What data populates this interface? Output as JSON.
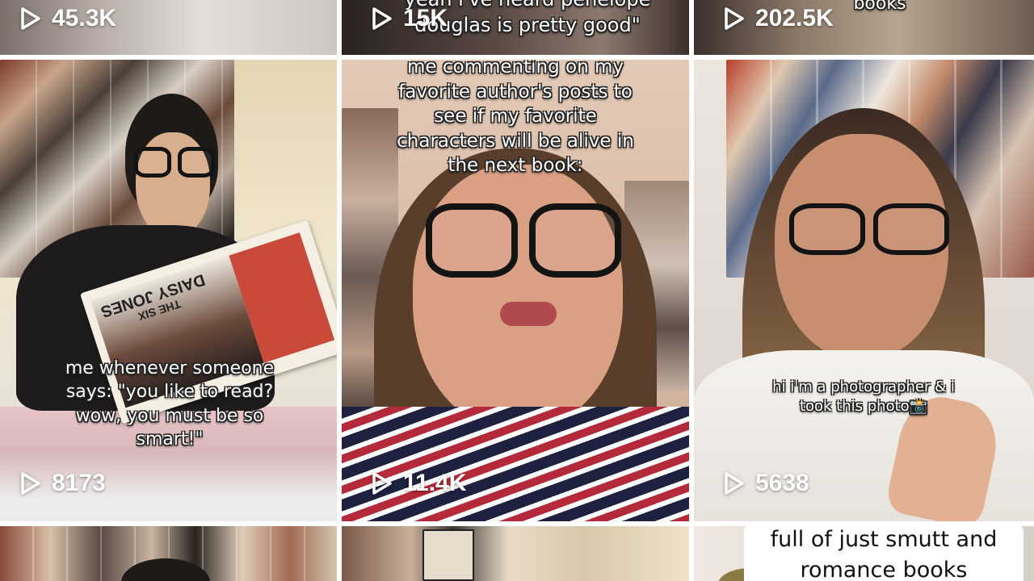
{
  "videos": [
    {
      "views": "45.3K"
    },
    {
      "views": "15K",
      "caption": [
        "yeah i've heard penelope",
        "douglas is pretty good\""
      ]
    },
    {
      "views": "202.5K",
      "caption": [
        "books"
      ]
    },
    {
      "views": "8173",
      "caption": [
        "me whenever someone",
        "says: \"you like to read?",
        "wow, you must be so",
        "smart!\""
      ],
      "book_title": "DAISY JONES",
      "book_subtitle": "THE SIX"
    },
    {
      "views": "11.4K",
      "caption": [
        "me commenting on my",
        "favorite author's posts to",
        "see if my favorite",
        "characters will be alive in",
        "the next book:"
      ]
    },
    {
      "views": "5638",
      "caption": [
        "hi i'm a photographer & i",
        "took this photo📸"
      ]
    },
    {},
    {},
    {
      "caption": [
        "full of just smutt and",
        "romance books"
      ]
    }
  ],
  "icons": {
    "play": "play-icon"
  },
  "colors": {
    "divider": "#ffffff",
    "text": "#ffffff"
  }
}
